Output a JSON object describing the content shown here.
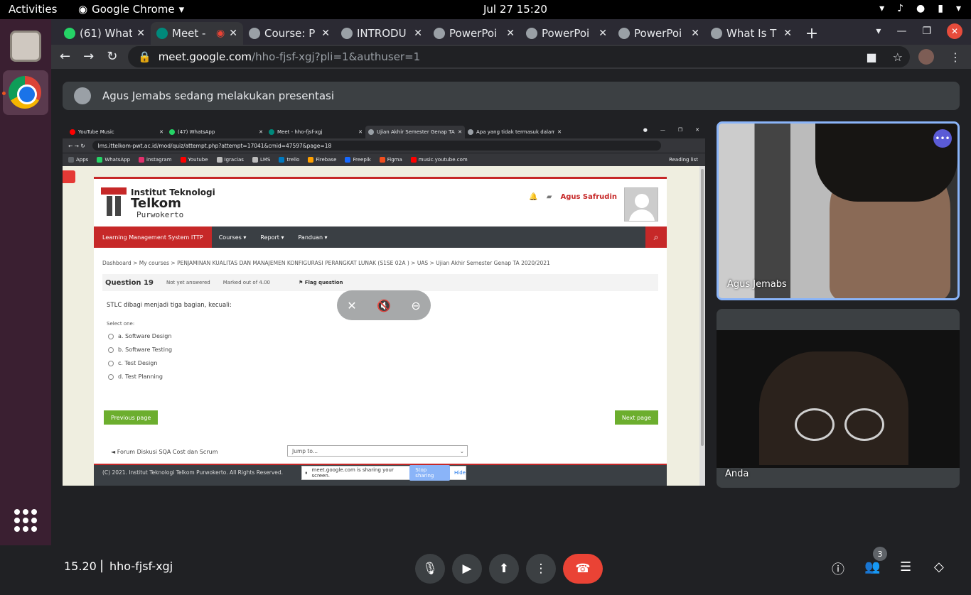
{
  "topbar": {
    "activities": "Activities",
    "app_name": "Google Chrome",
    "clock": "Jul 27  15:20"
  },
  "tabs": [
    {
      "title": "(61) What",
      "icon": "whatsapp-icon"
    },
    {
      "title": "Meet -",
      "icon": "meet-icon"
    },
    {
      "title": "Course: P",
      "icon": "moodle-icon"
    },
    {
      "title": "INTRODU",
      "icon": "globe-icon"
    },
    {
      "title": "PowerPoi",
      "icon": "globe-icon"
    },
    {
      "title": "PowerPoi",
      "icon": "globe-icon"
    },
    {
      "title": "PowerPoi",
      "icon": "globe-icon"
    },
    {
      "title": "What Is T",
      "icon": "globe-icon"
    }
  ],
  "address": {
    "host": "meet.google.com",
    "path": "/hho-fjsf-xgj?pli=1&authuser=1"
  },
  "banner": {
    "text": "Agus Jemabs sedang melakukan presentasi"
  },
  "presented": {
    "tabs": [
      {
        "title": "YouTube Music"
      },
      {
        "title": "(47) WhatsApp"
      },
      {
        "title": "Meet - hho-fjsf-xgj"
      },
      {
        "title": "Ujian Akhir Semester Genap TA 2"
      },
      {
        "title": "Apa yang tidak termasuk dalam"
      }
    ],
    "url": "lms.ittelkom-pwt.ac.id/mod/quiz/attempt.php?attempt=17041&cmid=47597&page=18",
    "bookmarks": [
      "Apps",
      "WhatsApp",
      "instagram",
      "Youtube",
      "Igracias",
      "LMS",
      "trello",
      "Firebase",
      "Freepik",
      "Figma",
      "music.youtube.com"
    ],
    "reading_list": "Reading list",
    "logo": {
      "line1": "Institut Teknologi",
      "line2": "Telkom",
      "line3": "Purwokerto"
    },
    "user_name": "Agus Safrudin",
    "nav": {
      "home": "Learning Management System ITTP",
      "items": [
        "Courses ▾",
        "Report ▾",
        "Panduan ▾"
      ]
    },
    "breadcrumb": "Dashboard  >  My courses  >  PENJAMINAN KUALITAS DAN MANAJEMEN KONFIGURASI PERANGKAT LUNAK (S1SE 02A )  >  UAS  >  Ujian Akhir Semester Genap TA 2020/2021",
    "question": {
      "number": "Question 19",
      "status": "Not yet answered",
      "marks": "Marked out of 4.00",
      "flag": "Flag question",
      "text": "STLC dibagi menjadi tiga bagian, kecuali:",
      "select": "Select one:"
    },
    "options": [
      "a. Software Design",
      "b. Software Testing",
      "c. Test Design",
      "d. Test Planning"
    ],
    "prev": "Previous page",
    "next": "Next page",
    "forum": "◄ Forum Diskusi SQA Cost dan Scrum",
    "jump": "Jump to...",
    "footer": "(C) 2021. Institut Teknologi Telkom Purwokerto. All Rights Reserved.",
    "share": {
      "text": "meet.google.com is sharing your screen.",
      "stop": "Stop sharing",
      "hide": "Hide"
    }
  },
  "participants": [
    {
      "name": "Agus Jemabs"
    },
    {
      "name": "Anda"
    }
  ],
  "bottom": {
    "time": "15.20",
    "code": "hho-fjsf-xgj",
    "people_count": "3"
  },
  "colors": {
    "accent_red": "#c62828",
    "meet_end": "#ea4335",
    "active_border": "#8ab4f8"
  }
}
